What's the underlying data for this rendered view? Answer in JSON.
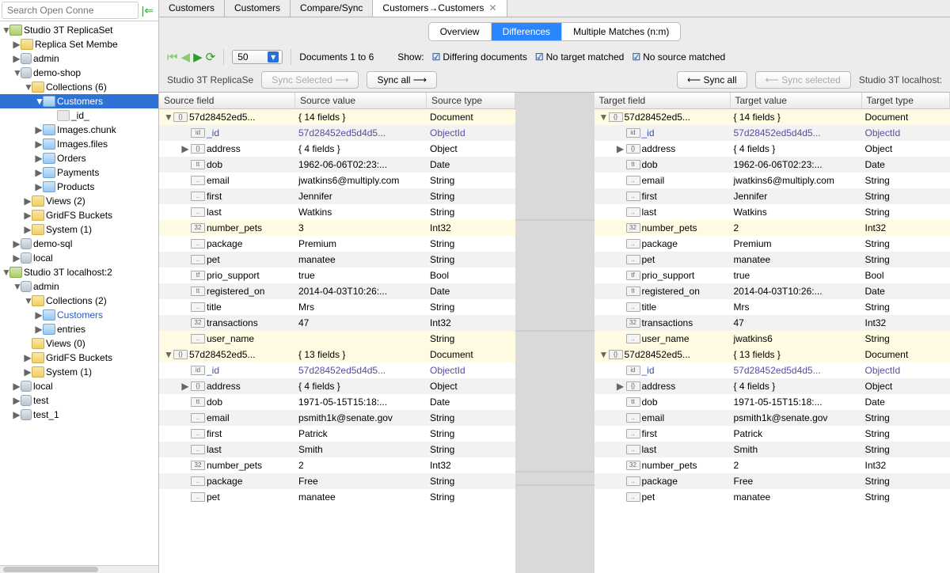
{
  "search": {
    "placeholder": "Search Open Conne"
  },
  "tree": {
    "rs": "Studio 3T ReplicaSet",
    "replica_members": "Replica Set Membe",
    "admin": "admin",
    "demo_shop": "demo-shop",
    "collections6": "Collections (6)",
    "customers": "Customers",
    "id_field": "_id_",
    "images_chunks": "Images.chunk",
    "images_files": "Images.files",
    "orders": "Orders",
    "payments": "Payments",
    "products": "Products",
    "views2": "Views (2)",
    "gridfs": "GridFS Buckets",
    "system1": "System (1)",
    "demo_sql": "demo-sql",
    "local": "local",
    "localhost": "Studio 3T localhost:2",
    "admin2": "admin",
    "collections2": "Collections (2)",
    "customers2": "Customers",
    "entries": "entries",
    "views0": "Views (0)",
    "gridfs2": "GridFS Buckets",
    "system1b": "System (1)",
    "local2": "local",
    "test": "test",
    "test1": "test_1"
  },
  "tabs": {
    "t1": "Customers",
    "t2": "Customers",
    "t3": "Compare/Sync",
    "t4": "Customers→Customers"
  },
  "subtabs": {
    "overview": "Overview",
    "diff": "Differences",
    "multi": "Multiple Matches (n:m)"
  },
  "toolbar": {
    "page_size": "50",
    "doc_range": "Documents 1 to 6",
    "show": "Show:",
    "differing": "Differing documents",
    "no_target": "No target matched",
    "no_source": "No source matched"
  },
  "sync": {
    "src_conn": "Studio 3T ReplicaSe",
    "sync_sel_r": "Sync Selected ⟶",
    "sync_all_r": "Sync all ⟶",
    "sync_all_l": "⟵ Sync all",
    "sync_sel_l": "⟵ Sync selected",
    "tgt_conn": "Studio 3T localhost:"
  },
  "headers": {
    "src_field": "Source field",
    "src_val": "Source value",
    "src_type": "Source type",
    "tgt_field": "Target field",
    "tgt_val": "Target value",
    "tgt_type": "Target type"
  },
  "source_rows": [
    {
      "k": "doc",
      "depth": 0,
      "exp": "▼",
      "ico": "{}",
      "field": "57d28452ed5...",
      "value": "{ 14 fields }",
      "type": "Document"
    },
    {
      "k": "id",
      "depth": 1,
      "ico": "id",
      "field": "_id",
      "value": "57d28452ed5d4d5...",
      "type": "ObjectId"
    },
    {
      "k": "r",
      "depth": 1,
      "exp": "▶",
      "ico": "{}",
      "field": "address",
      "value": "{ 4 fields }",
      "type": "Object"
    },
    {
      "k": "r",
      "depth": 1,
      "ico": "tt",
      "field": "dob",
      "value": "1962-06-06T02:23:...",
      "type": "Date"
    },
    {
      "k": "r",
      "depth": 1,
      "ico": "..",
      "field": "email",
      "value": "jwatkins6@multiply.com",
      "type": "String"
    },
    {
      "k": "r",
      "depth": 1,
      "ico": "..",
      "field": "first",
      "value": "Jennifer",
      "type": "String"
    },
    {
      "k": "r",
      "depth": 1,
      "ico": "..",
      "field": "last",
      "value": "Watkins",
      "type": "String"
    },
    {
      "k": "diff",
      "depth": 1,
      "ico": "32",
      "field": "number_pets",
      "value": "3",
      "type": "Int32"
    },
    {
      "k": "r",
      "depth": 1,
      "ico": "..",
      "field": "package",
      "value": "Premium",
      "type": "String"
    },
    {
      "k": "r",
      "depth": 1,
      "ico": "..",
      "field": "pet",
      "value": "manatee",
      "type": "String"
    },
    {
      "k": "r",
      "depth": 1,
      "ico": "tf",
      "field": "prio_support",
      "value": "true",
      "type": "Bool"
    },
    {
      "k": "r",
      "depth": 1,
      "ico": "tt",
      "field": "registered_on",
      "value": "2014-04-03T10:26:...",
      "type": "Date"
    },
    {
      "k": "r",
      "depth": 1,
      "ico": "..",
      "field": "title",
      "value": "Mrs",
      "type": "String"
    },
    {
      "k": "r",
      "depth": 1,
      "ico": "32",
      "field": "transactions",
      "value": "47",
      "type": "Int32"
    },
    {
      "k": "diff",
      "depth": 1,
      "ico": "..",
      "field": "user_name",
      "value": "",
      "type": "String"
    },
    {
      "k": "doc",
      "depth": 0,
      "exp": "▼",
      "ico": "{}",
      "field": "57d28452ed5...",
      "value": "{ 13 fields }",
      "type": "Document"
    },
    {
      "k": "id",
      "depth": 1,
      "ico": "id",
      "field": "_id",
      "value": "57d28452ed5d4d5...",
      "type": "ObjectId"
    },
    {
      "k": "r",
      "depth": 1,
      "exp": "▶",
      "ico": "{}",
      "field": "address",
      "value": "{ 4 fields }",
      "type": "Object"
    },
    {
      "k": "r",
      "depth": 1,
      "ico": "tt",
      "field": "dob",
      "value": "1971-05-15T15:18:...",
      "type": "Date"
    },
    {
      "k": "r",
      "depth": 1,
      "ico": "..",
      "field": "email",
      "value": "psmith1k@senate.gov",
      "type": "String"
    },
    {
      "k": "r",
      "depth": 1,
      "ico": "..",
      "field": "first",
      "value": "Patrick",
      "type": "String"
    },
    {
      "k": "r",
      "depth": 1,
      "ico": "..",
      "field": "last",
      "value": "Smith",
      "type": "String"
    },
    {
      "k": "r",
      "depth": 1,
      "ico": "32",
      "field": "number_pets",
      "value": "2",
      "type": "Int32"
    },
    {
      "k": "r",
      "depth": 1,
      "ico": "..",
      "field": "package",
      "value": "Free",
      "type": "String"
    },
    {
      "k": "r",
      "depth": 1,
      "ico": "..",
      "field": "pet",
      "value": "manatee",
      "type": "String"
    }
  ],
  "target_rows": [
    {
      "k": "doc",
      "depth": 0,
      "exp": "▼",
      "ico": "{}",
      "field": "57d28452ed5...",
      "value": "{ 14 fields }",
      "type": "Document"
    },
    {
      "k": "id",
      "depth": 1,
      "ico": "id",
      "field": "_id",
      "value": "57d28452ed5d4d5...",
      "type": "ObjectId"
    },
    {
      "k": "r",
      "depth": 1,
      "exp": "▶",
      "ico": "{}",
      "field": "address",
      "value": "{ 4 fields }",
      "type": "Object"
    },
    {
      "k": "r",
      "depth": 1,
      "ico": "tt",
      "field": "dob",
      "value": "1962-06-06T02:23:...",
      "type": "Date"
    },
    {
      "k": "r",
      "depth": 1,
      "ico": "..",
      "field": "email",
      "value": "jwatkins6@multiply.com",
      "type": "String"
    },
    {
      "k": "r",
      "depth": 1,
      "ico": "..",
      "field": "first",
      "value": "Jennifer",
      "type": "String"
    },
    {
      "k": "r",
      "depth": 1,
      "ico": "..",
      "field": "last",
      "value": "Watkins",
      "type": "String"
    },
    {
      "k": "diff",
      "depth": 1,
      "ico": "32",
      "field": "number_pets",
      "value": "2",
      "type": "Int32"
    },
    {
      "k": "r",
      "depth": 1,
      "ico": "..",
      "field": "package",
      "value": "Premium",
      "type": "String"
    },
    {
      "k": "r",
      "depth": 1,
      "ico": "..",
      "field": "pet",
      "value": "manatee",
      "type": "String"
    },
    {
      "k": "r",
      "depth": 1,
      "ico": "tf",
      "field": "prio_support",
      "value": "true",
      "type": "Bool"
    },
    {
      "k": "r",
      "depth": 1,
      "ico": "tt",
      "field": "registered_on",
      "value": "2014-04-03T10:26:...",
      "type": "Date"
    },
    {
      "k": "r",
      "depth": 1,
      "ico": "..",
      "field": "title",
      "value": "Mrs",
      "type": "String"
    },
    {
      "k": "r",
      "depth": 1,
      "ico": "32",
      "field": "transactions",
      "value": "47",
      "type": "Int32"
    },
    {
      "k": "diff",
      "depth": 1,
      "ico": "..",
      "field": "user_name",
      "value": "jwatkins6",
      "type": "String"
    },
    {
      "k": "doc",
      "depth": 0,
      "exp": "▼",
      "ico": "{}",
      "field": "57d28452ed5...",
      "value": "{ 13 fields }",
      "type": "Document"
    },
    {
      "k": "id",
      "depth": 1,
      "ico": "id",
      "field": "_id",
      "value": "57d28452ed5d4d5...",
      "type": "ObjectId"
    },
    {
      "k": "r",
      "depth": 1,
      "exp": "▶",
      "ico": "{}",
      "field": "address",
      "value": "{ 4 fields }",
      "type": "Object"
    },
    {
      "k": "r",
      "depth": 1,
      "ico": "tt",
      "field": "dob",
      "value": "1971-05-15T15:18:...",
      "type": "Date"
    },
    {
      "k": "r",
      "depth": 1,
      "ico": "..",
      "field": "email",
      "value": "psmith1k@senate.gov",
      "type": "String"
    },
    {
      "k": "r",
      "depth": 1,
      "ico": "..",
      "field": "first",
      "value": "Patrick",
      "type": "String"
    },
    {
      "k": "r",
      "depth": 1,
      "ico": "..",
      "field": "last",
      "value": "Smith",
      "type": "String"
    },
    {
      "k": "r",
      "depth": 1,
      "ico": "32",
      "field": "number_pets",
      "value": "2",
      "type": "Int32"
    },
    {
      "k": "r",
      "depth": 1,
      "ico": "..",
      "field": "package",
      "value": "Free",
      "type": "String"
    },
    {
      "k": "r",
      "depth": 1,
      "ico": "..",
      "field": "pet",
      "value": "manatee",
      "type": "String"
    }
  ]
}
